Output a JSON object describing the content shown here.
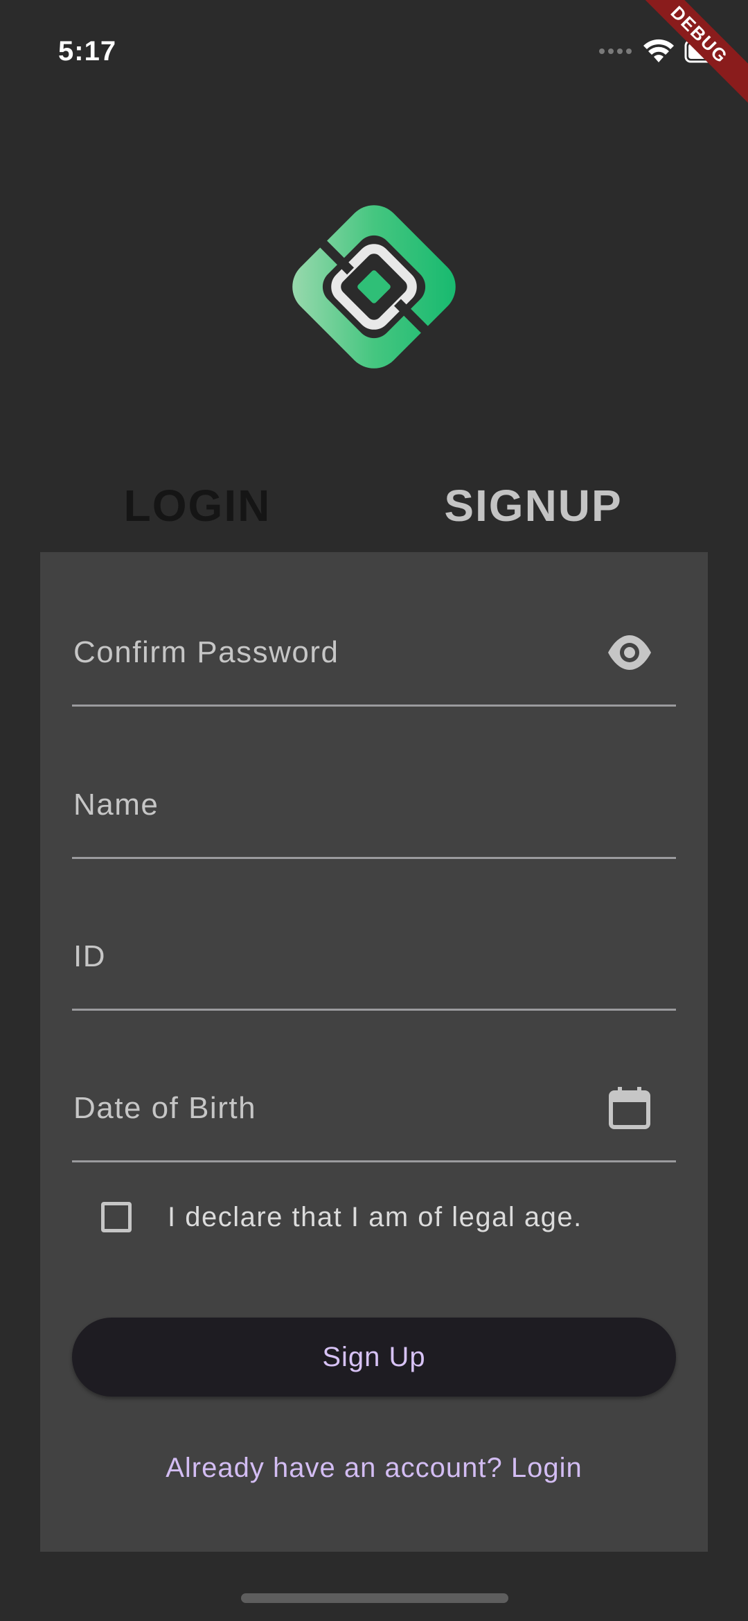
{
  "status_bar": {
    "time": "5:17",
    "icons": [
      "cellular-icon",
      "wifi-icon",
      "battery-icon"
    ]
  },
  "debug_banner": "DEBUG",
  "logo": {
    "icon": "app-logo-icon",
    "colors": [
      "#1db870",
      "#8fd6a8",
      "#2b2b2b"
    ]
  },
  "tabs": [
    {
      "label": "LOGIN",
      "active": false
    },
    {
      "label": "SIGNUP",
      "active": true
    }
  ],
  "form": {
    "fields": [
      {
        "label": "Confirm Password",
        "value": "",
        "icon": "eye-icon"
      },
      {
        "label": "Name",
        "value": ""
      },
      {
        "label": "ID",
        "value": ""
      },
      {
        "label": "Date of Birth",
        "value": "",
        "icon": "calendar-icon"
      }
    ],
    "checkbox": {
      "label": "I declare that I am of legal age.",
      "checked": false
    },
    "submit_label": "Sign Up",
    "login_link": "Already have an account? Login"
  },
  "colors": {
    "background": "#2b2b2b",
    "card": "#424242",
    "accent": "#d3bdf3",
    "button": "#1e1c22"
  }
}
